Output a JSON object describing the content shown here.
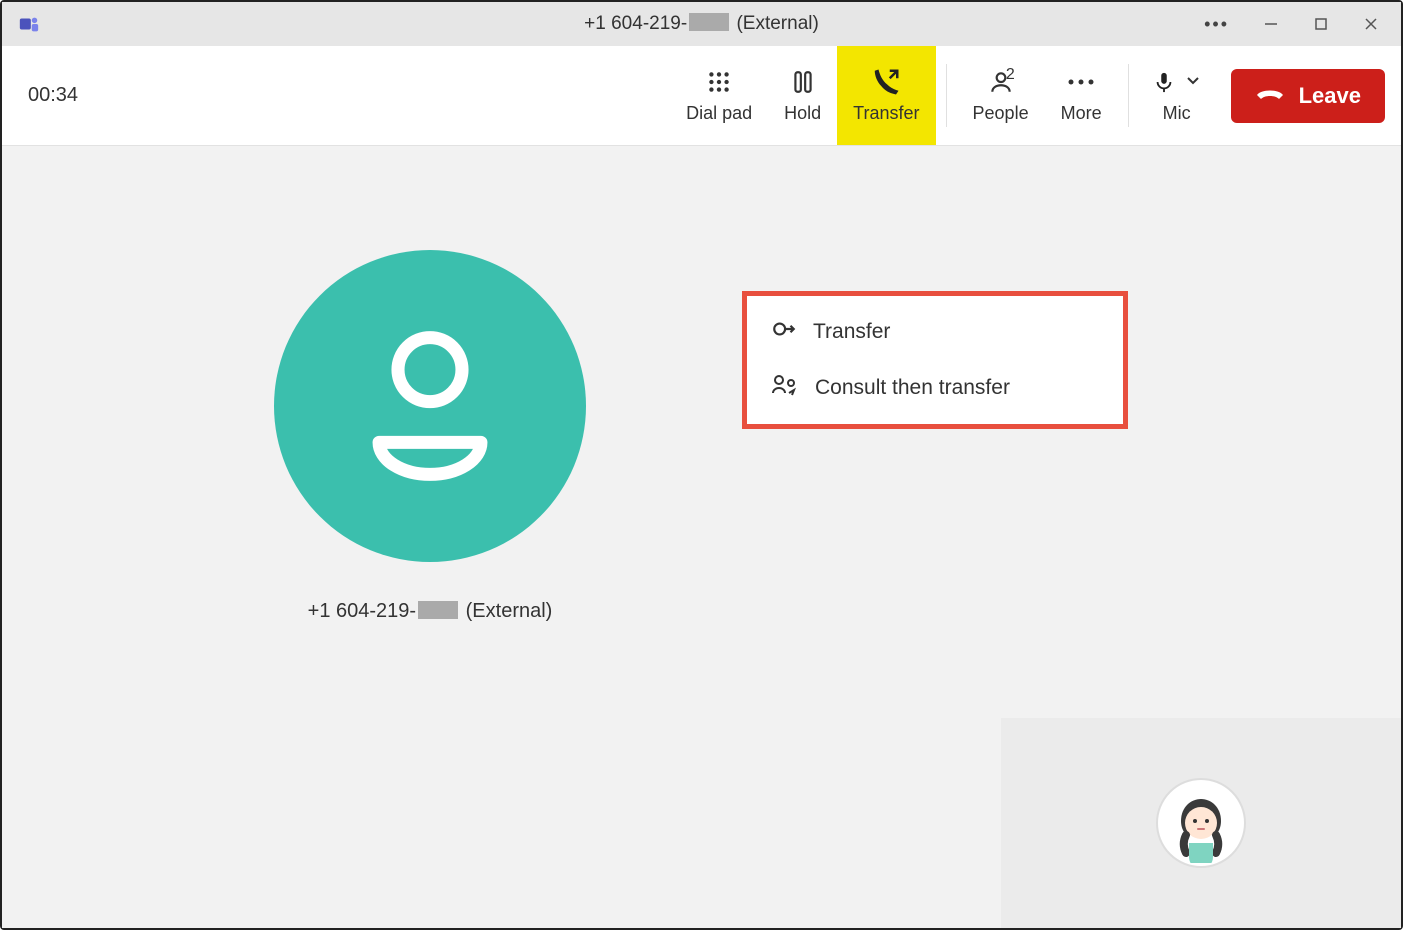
{
  "titlebar": {
    "phone_prefix": "+1 604-219-",
    "external_suffix": "(External)"
  },
  "toolbar": {
    "timer": "00:34",
    "dialpad_label": "Dial pad",
    "hold_label": "Hold",
    "transfer_label": "Transfer",
    "people_label": "People",
    "people_count": "2",
    "more_label": "More",
    "mic_label": "Mic",
    "leave_label": "Leave"
  },
  "dropdown": {
    "item_transfer": "Transfer",
    "item_consult": "Consult then transfer"
  },
  "participant": {
    "phone_prefix": "+1 604-219-",
    "external_suffix": "(External)"
  },
  "colors": {
    "avatar_bg": "#3bbfad",
    "transfer_highlight": "#f3e600",
    "leave_bg": "#cc1f1a",
    "dropdown_border": "#e84f3e"
  }
}
